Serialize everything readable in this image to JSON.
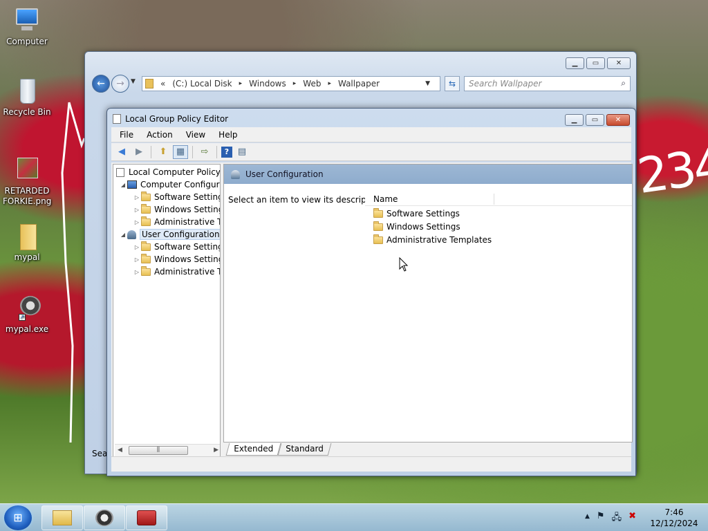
{
  "desktop": {
    "icons": [
      {
        "label": "Computer"
      },
      {
        "label": "Recycle Bin"
      },
      {
        "label": "RETARDED FORKIE.png"
      },
      {
        "label": "mypal"
      },
      {
        "label": "mypal.exe"
      }
    ],
    "scribble_text": "234"
  },
  "explorer": {
    "breadcrumb": [
      "«",
      "(C:) Local Disk",
      "▸",
      "Windows",
      "▸",
      "Web",
      "▸",
      "Wallpaper"
    ],
    "search_placeholder": "Search Wallpaper",
    "status_left": "Sear"
  },
  "gpedit": {
    "title": "Local Group Policy Editor",
    "menu": [
      "File",
      "Action",
      "View",
      "Help"
    ],
    "tree": {
      "root": "Local Computer Policy",
      "computer": "Computer Configura",
      "computer_children": [
        "Software Settings",
        "Windows Setting",
        "Administrative Te"
      ],
      "user": "User Configuration",
      "user_children": [
        "Software Settings",
        "Windows Setting",
        "Administrative Te"
      ]
    },
    "pane_title": "User Configuration",
    "description": "Select an item to view its description.",
    "column_name": "Name",
    "items": [
      "Software Settings",
      "Windows Settings",
      "Administrative Templates"
    ],
    "tabs": [
      "Extended",
      "Standard"
    ]
  },
  "taskbar": {
    "time": "7:46",
    "date": "12/12/2024"
  }
}
